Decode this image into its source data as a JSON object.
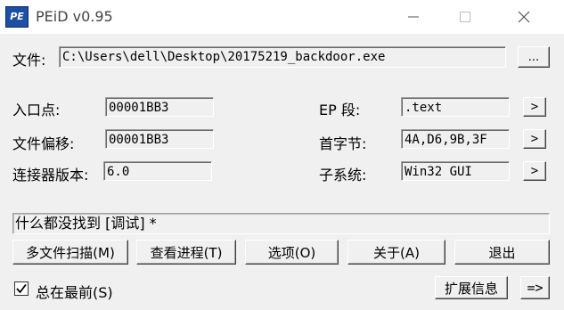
{
  "window": {
    "title": "PEiD v0.95",
    "icon_text": "PE",
    "icons": {
      "app": "peid-app-icon",
      "minimize": "minimize-icon",
      "maximize": "maximize-icon",
      "close": "close-icon"
    }
  },
  "file": {
    "label": "文件:",
    "path": "C:\\Users\\dell\\Desktop\\20175219_backdoor.exe",
    "browse_label": "..."
  },
  "info": {
    "entry_point": {
      "label": "入口点:",
      "value": "00001BB3"
    },
    "file_offset": {
      "label": "文件偏移:",
      "value": "00001BB3"
    },
    "linker_version": {
      "label": "连接器版本:",
      "value": "6.0"
    },
    "ep_section": {
      "label": "EP 段:",
      "value": ".text",
      "button": ">"
    },
    "first_bytes": {
      "label": "首字节:",
      "value": "4A,D6,9B,3F",
      "button": ">"
    },
    "subsystem": {
      "label": "子系统:",
      "value": "Win32 GUI",
      "button": ">"
    }
  },
  "status": {
    "text": "什么都没找到 [调试] *"
  },
  "buttons": {
    "multi_scan": "多文件扫描(M)",
    "task_viewer": "查看进程(T)",
    "options": "选项(O)",
    "about": "关于(A)",
    "exit": "退出",
    "plugins": "扩展信息",
    "more": "=>"
  },
  "always_on_top": {
    "label": "总在最前(S)",
    "checked": true
  }
}
